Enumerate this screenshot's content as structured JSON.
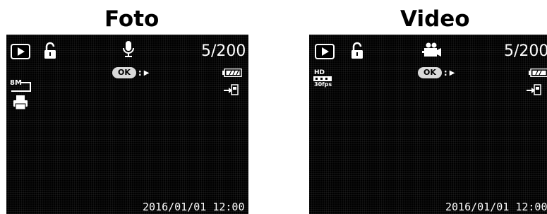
{
  "panels": {
    "foto": {
      "title": "Foto",
      "counter": "5/200",
      "ok_label": "OK",
      "ok_sep": ":",
      "datetime": "2016/01/01 12:00",
      "resolution_label": "8M",
      "icons": [
        "playback-icon",
        "lock-icon",
        "microphone-icon",
        "battery-full-icon",
        "resolution-8m-icon",
        "print-icon",
        "usb-connect-icon"
      ]
    },
    "video": {
      "title": "Video",
      "counter": "5/200",
      "ok_label": "OK",
      "ok_sep": ":",
      "datetime": "2016/01/01 12:00",
      "hd_label": "HD",
      "fps_label": "30fps",
      "icons": [
        "playback-icon",
        "lock-icon",
        "video-camera-icon",
        "battery-full-icon",
        "hd-30fps-icon",
        "usb-connect-icon"
      ]
    }
  }
}
